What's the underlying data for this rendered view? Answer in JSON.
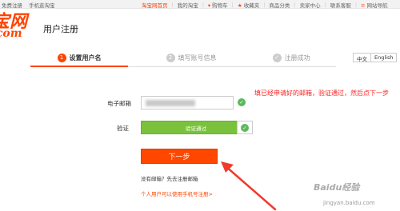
{
  "topbar": {
    "left": [
      "免费注册",
      "手机逛淘宝"
    ],
    "right": [
      {
        "label": "淘宝网首页",
        "accent": true
      },
      {
        "label": "我的淘宝"
      },
      {
        "label": "购物车",
        "icon": "cart-icon"
      },
      {
        "label": "收藏夹",
        "icon": "star-icon"
      },
      {
        "label": "商品分类"
      },
      {
        "label": "卖家中心"
      },
      {
        "label": "联系客服"
      },
      {
        "label": "网站导航",
        "icon": "menu-icon"
      }
    ]
  },
  "header": {
    "logo_line1": "宝网",
    "logo_line2": ".com",
    "title": "用户注册"
  },
  "steps": [
    {
      "num": "1",
      "label": "设置用户名",
      "state": "active"
    },
    {
      "num": "2",
      "label": "填写账号信息",
      "state": "pending"
    },
    {
      "num": "✓",
      "label": "注册成功",
      "state": "pending"
    }
  ],
  "lang": {
    "cn": "中文",
    "en": "English"
  },
  "form": {
    "email_label": "电子邮箱",
    "email_hint": "填已经申请好的邮箱，验证通过，然后点下一步",
    "verify_label": "验证",
    "verify_text": "验证通过",
    "next_button": "下一步",
    "no_email_link": "没有邮箱？先去注册邮箱",
    "phone_link": "个人用户可以使用手机号注册>"
  },
  "watermark": {
    "text": "Baidu经验",
    "url_text": "jingyan.baidu.com"
  },
  "colors": {
    "accent": "#ff4400",
    "success": "#7ac23c",
    "hint": "#ff2222"
  }
}
